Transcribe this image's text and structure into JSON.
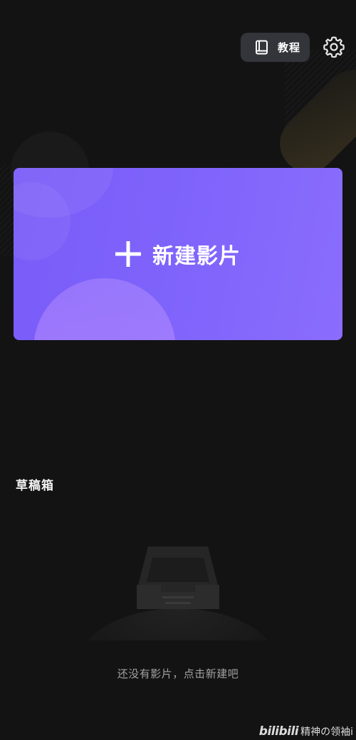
{
  "header": {
    "tutorial_label": "教程",
    "tutorial_icon": "book-icon",
    "settings_icon": "gear-icon"
  },
  "new_movie": {
    "label": "新建影片",
    "icon": "plus-icon"
  },
  "drafts": {
    "title": "草稿箱",
    "empty_icon": "inbox-tray-icon",
    "empty_message": "还没有影片，点击新建吧"
  },
  "watermark": {
    "logo": "bilibili",
    "user": "精神の领袖i"
  },
  "colors": {
    "background": "#131313",
    "card_accent": "#7e63fb",
    "button_bg": "#34353b"
  }
}
